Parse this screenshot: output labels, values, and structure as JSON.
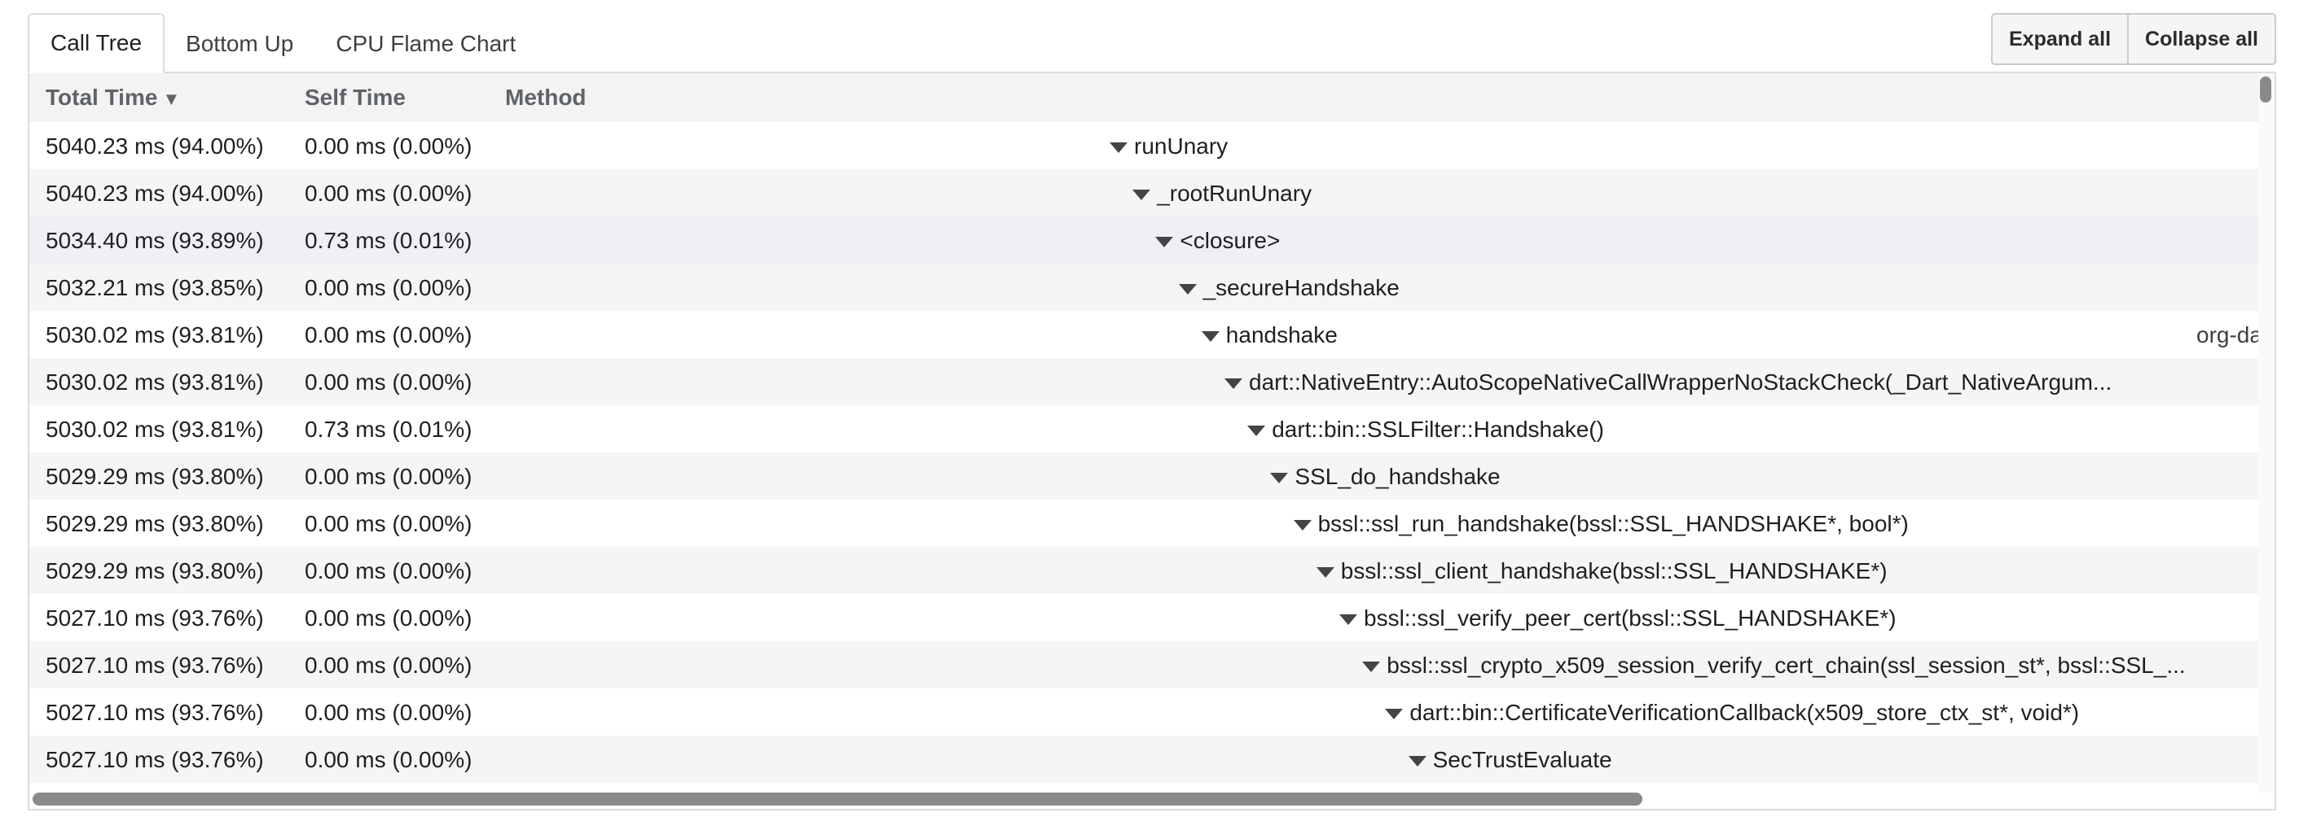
{
  "tabs": [
    {
      "label": "Call Tree",
      "active": true
    },
    {
      "label": "Bottom Up",
      "active": false
    },
    {
      "label": "CPU Flame Chart",
      "active": false
    }
  ],
  "toolbar": {
    "expand_label": "Expand all",
    "collapse_label": "Collapse all"
  },
  "table": {
    "headers": {
      "total": "Total Time",
      "sort_indicator": "▼",
      "self": "Self Time",
      "method": "Method"
    },
    "rows": [
      {
        "total": "5040.23 ms (94.00%)",
        "self": "0.00 ms (0.00%)",
        "method": "runUnary",
        "depth": 0
      },
      {
        "total": "5040.23 ms (94.00%)",
        "self": "0.00 ms (0.00%)",
        "method": "_rootRunUnary",
        "depth": 1
      },
      {
        "total": "5034.40 ms (93.89%)",
        "self": "0.73 ms (0.01%)",
        "method": "<closure>",
        "depth": 2
      },
      {
        "total": "5032.21 ms (93.85%)",
        "self": "0.00 ms (0.00%)",
        "method": "_secureHandshake",
        "depth": 3
      },
      {
        "total": "5030.02 ms (93.81%)",
        "self": "0.00 ms (0.00%)",
        "method": "handshake",
        "depth": 4,
        "source": "org-da"
      },
      {
        "total": "5030.02 ms (93.81%)",
        "self": "0.00 ms (0.00%)",
        "method": "dart::NativeEntry::AutoScopeNativeCallWrapperNoStackCheck(_Dart_NativeArgum...",
        "depth": 5
      },
      {
        "total": "5030.02 ms (93.81%)",
        "self": "0.73 ms (0.01%)",
        "method": "dart::bin::SSLFilter::Handshake()",
        "depth": 6
      },
      {
        "total": "5029.29 ms (93.80%)",
        "self": "0.00 ms (0.00%)",
        "method": "SSL_do_handshake",
        "depth": 7
      },
      {
        "total": "5029.29 ms (93.80%)",
        "self": "0.00 ms (0.00%)",
        "method": "bssl::ssl_run_handshake(bssl::SSL_HANDSHAKE*, bool*)",
        "depth": 8
      },
      {
        "total": "5029.29 ms (93.80%)",
        "self": "0.00 ms (0.00%)",
        "method": "bssl::ssl_client_handshake(bssl::SSL_HANDSHAKE*)",
        "depth": 9
      },
      {
        "total": "5027.10 ms (93.76%)",
        "self": "0.00 ms (0.00%)",
        "method": "bssl::ssl_verify_peer_cert(bssl::SSL_HANDSHAKE*)",
        "depth": 10
      },
      {
        "total": "5027.10 ms (93.76%)",
        "self": "0.00 ms (0.00%)",
        "method": "bssl::ssl_crypto_x509_session_verify_cert_chain(ssl_session_st*, bssl::SSL_...",
        "depth": 11
      },
      {
        "total": "5027.10 ms (93.76%)",
        "self": "0.00 ms (0.00%)",
        "method": "dart::bin::CertificateVerificationCallback(x509_store_ctx_st*, void*)",
        "depth": 12
      },
      {
        "total": "5027.10 ms (93.76%)",
        "self": "0.00 ms (0.00%)",
        "method": "SecTrustEvaluate",
        "depth": 13
      }
    ]
  }
}
